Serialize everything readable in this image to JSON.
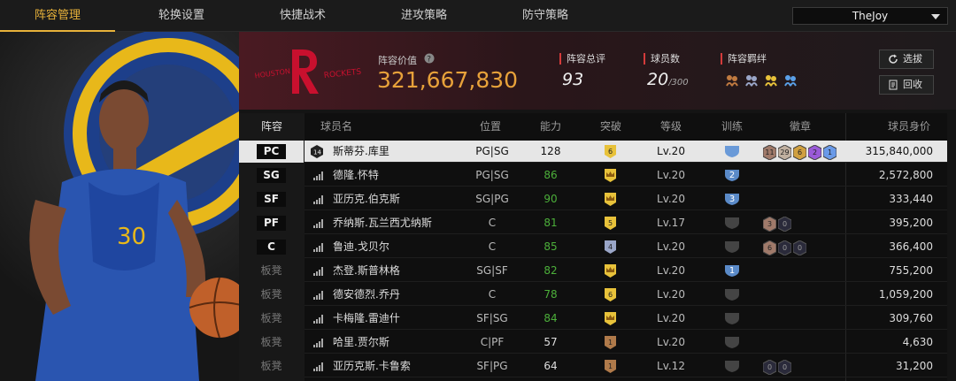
{
  "tabs": [
    "阵容管理",
    "轮换设置",
    "快捷战术",
    "进攻策略",
    "防守策略"
  ],
  "user": {
    "name": "TheJoy"
  },
  "header": {
    "team_logo_text": "HOUSTON ROCKETS",
    "value_label": "阵容价值",
    "value": "321,667,830",
    "rating_label": "阵容总评",
    "rating": "93",
    "count_label": "球员数",
    "count": "20",
    "count_max": "/300",
    "bond_label": "阵容羁绊",
    "select_btn": "选拔",
    "recycle_btn": "回收"
  },
  "columns": [
    "阵容",
    "球员名",
    "位置",
    "能力",
    "突破",
    "等级",
    "训练",
    "徽章",
    "球员身价"
  ],
  "colors": {
    "accent": "#e8b23a",
    "green": "#4caf3a",
    "red_stripe": "#d43b3b"
  },
  "rows": [
    {
      "slot": "PC",
      "name": "斯蒂芬.库里",
      "pos": "PG|SG",
      "ability": "128",
      "break": "6",
      "break_type": "gold",
      "level": "Lv.20",
      "train": "crown",
      "badges": [
        "11",
        "29",
        "6",
        "2",
        "1"
      ],
      "price": "315,840,000",
      "selected": true
    },
    {
      "slot": "SG",
      "name": "德隆.怀特",
      "pos": "PG|SG",
      "ability": "86",
      "break": "",
      "break_type": "crown",
      "level": "Lv.20",
      "train": "2",
      "badges": [],
      "price": "2,572,800"
    },
    {
      "slot": "SF",
      "name": "亚历克.伯克斯",
      "pos": "SG|PG",
      "ability": "90",
      "break": "",
      "break_type": "crown",
      "level": "Lv.20",
      "train": "3",
      "badges": [],
      "price": "333,440"
    },
    {
      "slot": "PF",
      "name": "乔纳斯.瓦兰西尤纳斯",
      "pos": "C",
      "ability": "81",
      "break": "5",
      "break_type": "gold",
      "level": "Lv.17",
      "train": "",
      "badges": [
        "3",
        "0"
      ],
      "price": "395,200"
    },
    {
      "slot": "C",
      "name": "鲁迪.戈贝尔",
      "pos": "C",
      "ability": "85",
      "break": "4",
      "break_type": "silver",
      "level": "Lv.20",
      "train": "",
      "badges": [
        "6",
        "0",
        "0"
      ],
      "price": "366,400"
    },
    {
      "slot": "板凳",
      "name": "杰登.斯普林格",
      "pos": "SG|SF",
      "ability": "82",
      "break": "",
      "break_type": "crown",
      "level": "Lv.20",
      "train": "1",
      "badges": [],
      "price": "755,200"
    },
    {
      "slot": "板凳",
      "name": "德安德烈.乔丹",
      "pos": "C",
      "ability": "78",
      "break": "6",
      "break_type": "gold",
      "level": "Lv.20",
      "train": "",
      "badges": [],
      "price": "1,059,200"
    },
    {
      "slot": "板凳",
      "name": "卡梅隆.雷迪什",
      "pos": "SF|SG",
      "ability": "84",
      "break": "",
      "break_type": "crown",
      "level": "Lv.20",
      "train": "",
      "badges": [],
      "price": "309,760"
    },
    {
      "slot": "板凳",
      "name": "哈里.贾尔斯",
      "pos": "C|PF",
      "ability": "57",
      "break": "1",
      "break_type": "bronze",
      "level": "Lv.20",
      "train": "",
      "badges": [],
      "price": "4,630"
    },
    {
      "slot": "板凳",
      "name": "亚历克斯.卡鲁索",
      "pos": "SF|PG",
      "ability": "64",
      "break": "1",
      "break_type": "bronze",
      "level": "Lv.12",
      "train": "",
      "badges": [
        "0",
        "0"
      ],
      "price": "31,200"
    }
  ]
}
